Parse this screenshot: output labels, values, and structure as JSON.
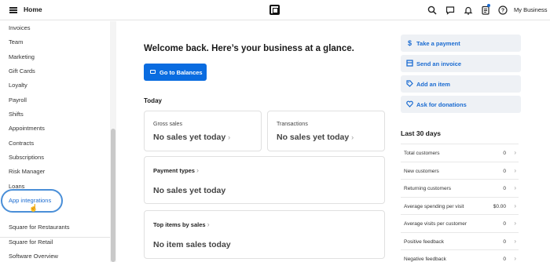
{
  "header": {
    "home_label": "Home",
    "business_label": "My Business",
    "icons": [
      "menu-icon",
      "square-logo",
      "search-icon",
      "chat-icon",
      "bell-icon",
      "clipboard-icon",
      "help-icon"
    ]
  },
  "sidebar": {
    "items": [
      "Invoices",
      "Team",
      "Marketing",
      "Gift Cards",
      "Loyalty",
      "Payroll",
      "Shifts",
      "Appointments",
      "Contracts",
      "Subscriptions",
      "Risk Manager",
      "Loans",
      "App integrations"
    ],
    "footer_items": [
      "Square for Restaurants",
      "Square for Retail",
      "Software Overview"
    ],
    "highlighted_item": "App integrations"
  },
  "main": {
    "welcome": "Welcome back. Here’s your business at a glance.",
    "balances_button": "Go to Balances",
    "today_label": "Today",
    "gross_sales_label": "Gross sales",
    "gross_sales_value": "No sales yet today",
    "transactions_label": "Transactions",
    "transactions_value": "No sales yet today",
    "payment_types_label": "Payment types",
    "payment_types_value": "No sales yet today",
    "top_items_label": "Top items by sales",
    "top_items_value": "No item sales today"
  },
  "actions": [
    {
      "label": "Take a payment",
      "icon": "dollar-icon"
    },
    {
      "label": "Send an invoice",
      "icon": "invoice-icon"
    },
    {
      "label": "Add an item",
      "icon": "tag-icon"
    },
    {
      "label": "Ask for donations",
      "icon": "heart-icon"
    }
  ],
  "last30": {
    "title": "Last 30 days",
    "rows": [
      {
        "label": "Total customers",
        "value": "0"
      },
      {
        "label": "New customers",
        "value": "0"
      },
      {
        "label": "Returning customers",
        "value": "0"
      },
      {
        "label": "Average spending per visit",
        "value": "$0.00"
      },
      {
        "label": "Average visits per customer",
        "value": "0"
      },
      {
        "label": "Positive feedback",
        "value": "0"
      },
      {
        "label": "Negative feedback",
        "value": "0"
      }
    ]
  },
  "colors": {
    "accent": "#0a6ce0",
    "highlight_ring": "#4a8fd8"
  }
}
